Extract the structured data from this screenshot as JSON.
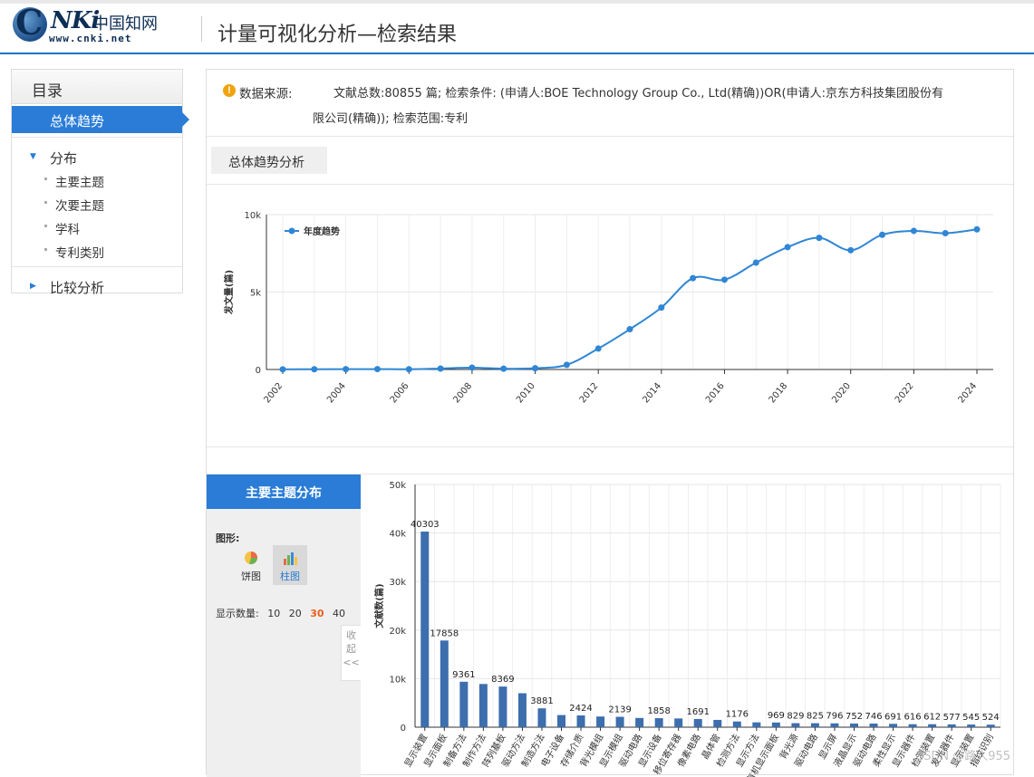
{
  "header": {
    "logo_url_text": "www.cnki.net",
    "logo_cn_text": "中国知网",
    "title": "计量可视化分析—检索结果"
  },
  "sidebar": {
    "heading": "目录",
    "active_item": "总体趋势",
    "group1": "分布",
    "sub_items": [
      "主要主题",
      "次要主题",
      "学科",
      "专利类别"
    ],
    "group2": "比较分析"
  },
  "source": {
    "label": "数据来源:",
    "line1": "文献总数:80855 篇; 检索条件: (申请人:BOE Technology Group Co., Ltd(精确))OR(申请人:京东方科技集团股份有",
    "line2": "限公司(精确)); 检索范围:专利"
  },
  "trend_tab": "总体趋势分析",
  "lower": {
    "panel_title": "主要主题分布",
    "shape_label": "图形:",
    "pie_label": "饼图",
    "bar_label": "柱图",
    "count_label": "显示数量:",
    "count_options": [
      "10",
      "20",
      "30",
      "40"
    ],
    "count_selected": "30",
    "collapse_label": "收起"
  },
  "watermark": "CSDN @路人955",
  "colors": {
    "accent": "#2a7cd6",
    "line": "#2f86d4",
    "bar": "#3d6eae"
  },
  "chart_data": [
    {
      "type": "line",
      "series": [
        {
          "name": "年度趋势",
          "x": [
            2002,
            2003,
            2004,
            2005,
            2006,
            2007,
            2008,
            2009,
            2010,
            2011,
            2012,
            2013,
            2014,
            2015,
            2016,
            2017,
            2018,
            2019,
            2020,
            2021,
            2022,
            2023,
            2024
          ],
          "values": [
            10,
            15,
            20,
            25,
            15,
            60,
            120,
            50,
            80,
            300,
            1350,
            2600,
            4000,
            5900,
            5800,
            6900,
            7900,
            8500,
            7700,
            8700,
            8950,
            8800,
            9050
          ]
        }
      ],
      "ylabel": "发文量(篇)",
      "ylim": [
        0,
        10000
      ],
      "yticks": [
        "0",
        "5k",
        "10k"
      ],
      "xticks": [
        "2002",
        "2004",
        "2006",
        "2008",
        "2010",
        "2012",
        "2014",
        "2016",
        "2018",
        "2020",
        "2022",
        "2024"
      ],
      "legend": "top-left",
      "grid": true
    },
    {
      "type": "bar",
      "ylabel": "文献数(篇)",
      "ylim": [
        0,
        50000
      ],
      "yticks": [
        "0",
        "10k",
        "20k",
        "30k",
        "40k",
        "50k"
      ],
      "categories": [
        "显示装置",
        "显示面板",
        "制备方法",
        "制作方法",
        "阵列基板",
        "驱动方法",
        "制造方法",
        "电子设备",
        "存储介质",
        "背光模组",
        "显示模组",
        "驱动电路",
        "显示设备",
        "移位寄存器",
        "像素电路",
        "晶体管",
        "检测方法",
        "显示方法",
        "有机显示面板",
        "背光源",
        "驱动电路",
        "显示屏",
        "液晶显示",
        "驱动电路",
        "柔性显示",
        "显示器件",
        "检测装置",
        "发光器件",
        "显示装置",
        "指纹识别"
      ],
      "values": [
        40303,
        17858,
        9361,
        8900,
        8369,
        7000,
        3881,
        2500,
        2424,
        2200,
        2139,
        1900,
        1858,
        1800,
        1691,
        1500,
        1176,
        1000,
        969,
        829,
        825,
        796,
        752,
        746,
        691,
        616,
        612,
        577,
        545,
        524
      ],
      "value_labels": [
        "40303",
        "17858",
        "9361",
        "",
        "8369",
        "",
        "3881",
        "",
        "2424",
        "",
        "2139",
        "",
        "1858",
        "",
        "1691",
        "",
        "1176",
        "",
        "969",
        "829",
        "825",
        "796",
        "752",
        "746",
        "691",
        "616",
        "612",
        "577",
        "545",
        "524"
      ],
      "grid": true
    }
  ]
}
